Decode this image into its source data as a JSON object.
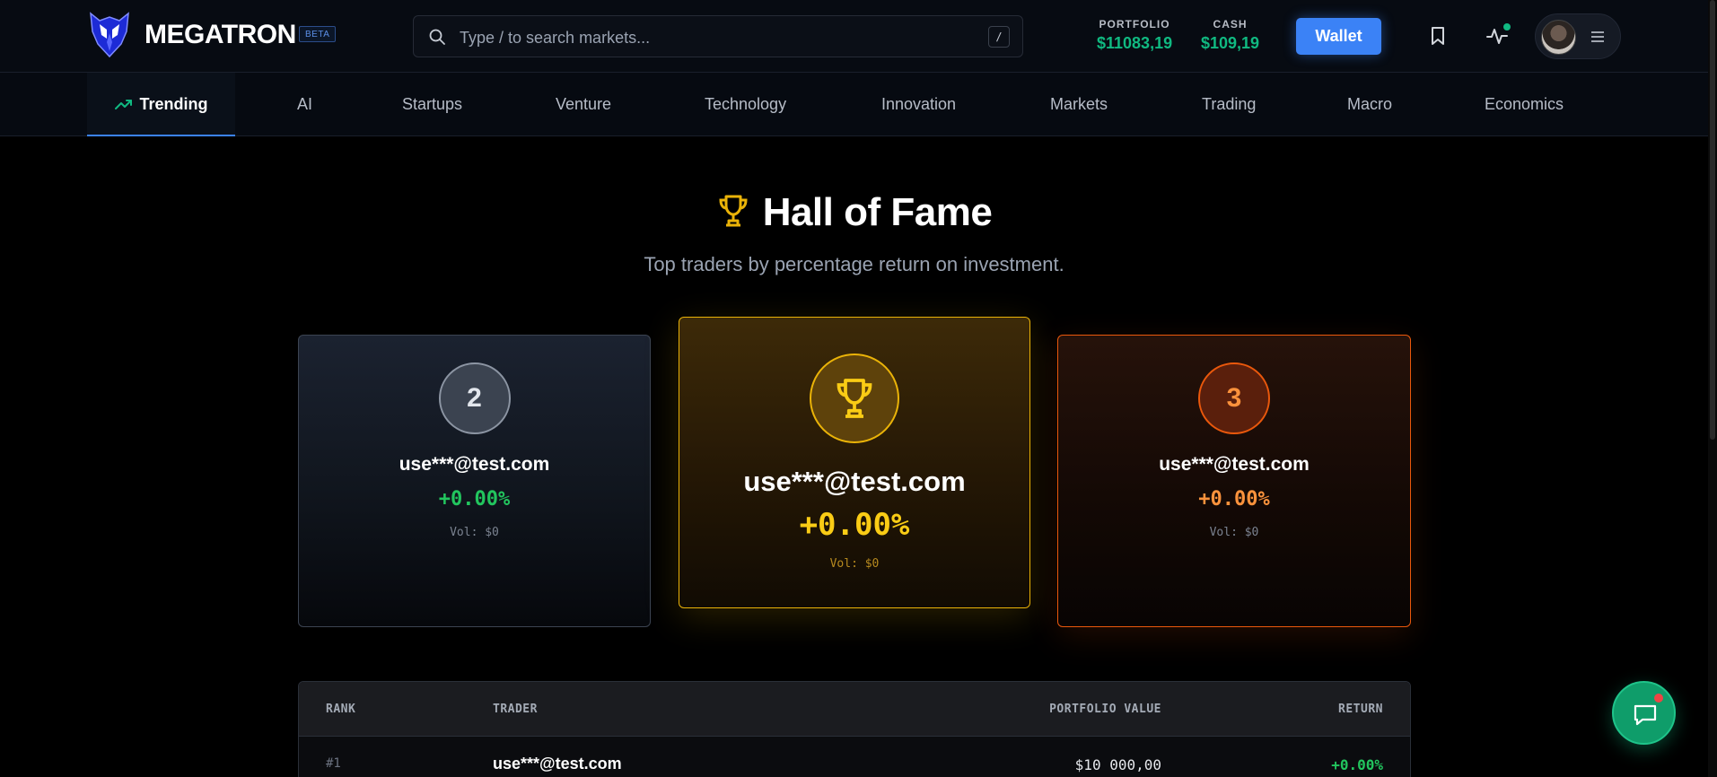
{
  "header": {
    "brand": "MEGATRON",
    "beta": "BETA",
    "search_placeholder": "Type / to search markets...",
    "search_shortcut": "/",
    "portfolio_label": "PORTFOLIO",
    "portfolio_value": "$11083,19",
    "cash_label": "CASH",
    "cash_value": "$109,19",
    "wallet_label": "Wallet",
    "accent": "#3b82f6",
    "positive_color": "#10b981"
  },
  "nav": {
    "tabs": [
      {
        "label": "Trending",
        "active": true
      },
      {
        "label": "AI"
      },
      {
        "label": "Startups"
      },
      {
        "label": "Venture"
      },
      {
        "label": "Technology"
      },
      {
        "label": "Innovation"
      },
      {
        "label": "Markets"
      },
      {
        "label": "Trading"
      },
      {
        "label": "Macro"
      },
      {
        "label": "Economics"
      }
    ]
  },
  "hero": {
    "title": "Hall of Fame",
    "subtitle": "Top traders by percentage return on investment."
  },
  "podium": {
    "second": {
      "rank": "2",
      "name": "use***@test.com",
      "return": "+0.00%",
      "volume": "Vol: $0"
    },
    "first": {
      "name": "use***@test.com",
      "return": "+0.00%",
      "volume": "Vol: $0"
    },
    "third": {
      "rank": "3",
      "name": "use***@test.com",
      "return": "+0.00%",
      "volume": "Vol: $0"
    }
  },
  "leaderboard": {
    "columns": {
      "rank": "RANK",
      "trader": "TRADER",
      "portfolio_value": "PORTFOLIO VALUE",
      "return": "RETURN"
    },
    "rows": [
      {
        "rank": "#1",
        "trader": "use***@test.com",
        "portfolio_value": "$10 000,00",
        "return": "+0.00%"
      }
    ]
  }
}
